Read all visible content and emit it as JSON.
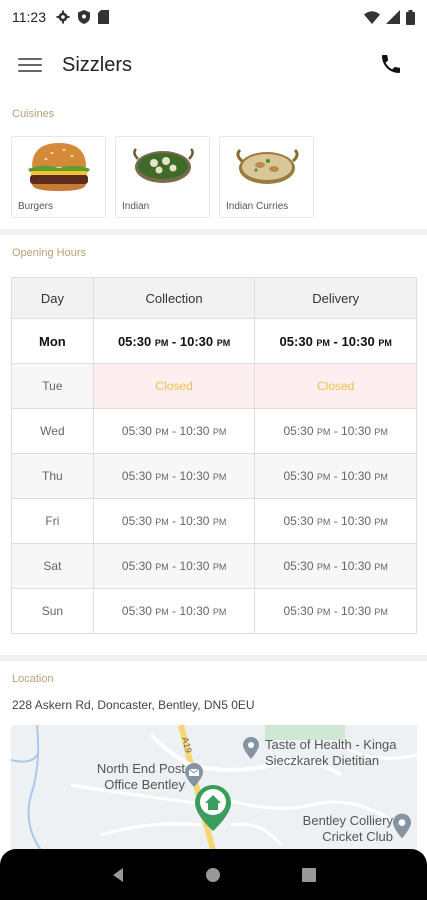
{
  "status_bar": {
    "time": "11:23"
  },
  "app_bar": {
    "title": "Sizzlers"
  },
  "cuisines": {
    "label": "Cuisines",
    "items": [
      {
        "name": "Burgers"
      },
      {
        "name": "Indian"
      },
      {
        "name": "Indian Curries"
      }
    ]
  },
  "opening_hours": {
    "label": "Opening Hours",
    "headers": {
      "day": "Day",
      "collection": "Collection",
      "delivery": "Delivery"
    },
    "rows": [
      {
        "day": "Mon",
        "collection_open": "05:30",
        "collection_close": "10:30",
        "delivery_open": "05:30",
        "delivery_close": "10:30"
      },
      {
        "day": "Tue",
        "collection": "Closed",
        "delivery": "Closed"
      },
      {
        "day": "Wed",
        "collection_open": "05:30",
        "collection_close": "10:30",
        "delivery_open": "05:30",
        "delivery_close": "10:30"
      },
      {
        "day": "Thu",
        "collection_open": "05:30",
        "collection_close": "10:30",
        "delivery_open": "05:30",
        "delivery_close": "10:30"
      },
      {
        "day": "Fri",
        "collection_open": "05:30",
        "collection_close": "10:30",
        "delivery_open": "05:30",
        "delivery_close": "10:30"
      },
      {
        "day": "Sat",
        "collection_open": "05:30",
        "collection_close": "10:30",
        "delivery_open": "05:30",
        "delivery_close": "10:30"
      },
      {
        "day": "Sun",
        "collection_open": "05:30",
        "collection_close": "10:30",
        "delivery_open": "05:30",
        "delivery_close": "10:30"
      }
    ],
    "pm": "PM",
    "separator": " - "
  },
  "location": {
    "label": "Location",
    "address": "228 Askern Rd, Doncaster, Bentley, DN5 0EU",
    "map": {
      "road_label": "A19",
      "places": [
        {
          "name": "Taste of Health - Kinga Sieczkarek Dietitian"
        },
        {
          "name": "North End Post Office Bentley"
        },
        {
          "name": "Bentley Colliery Cricket Club"
        }
      ]
    }
  },
  "colors": {
    "accent": "#b3a379",
    "closed_bg": "#fdeef0",
    "closed_text": "#f0c24a",
    "marker": "#3a9d5d"
  }
}
